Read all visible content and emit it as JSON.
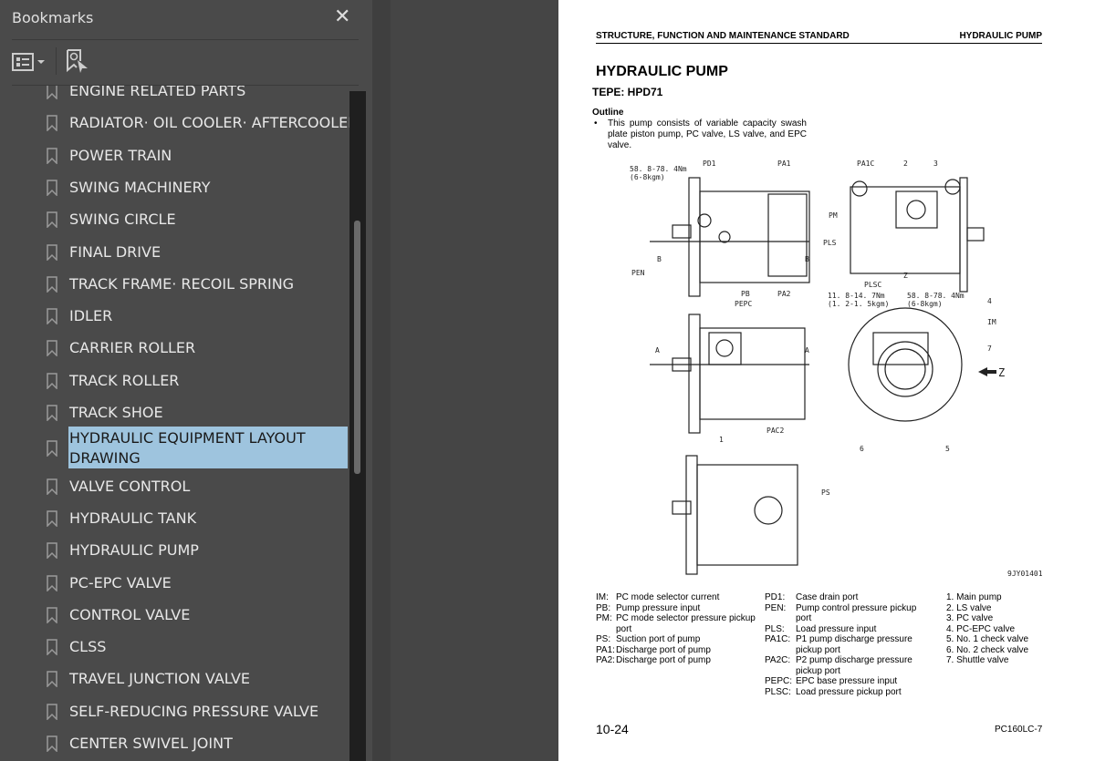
{
  "sidebar": {
    "title": "Bookmarks",
    "close_icon": "close-icon",
    "options_icon": "list-options-icon",
    "find_icon": "find-bookmark-icon",
    "items": [
      {
        "label": "ENGINE RELATED PARTS"
      },
      {
        "label": "RADIATOR· OIL COOLER· AFTERCOOLER"
      },
      {
        "label": "POWER TRAIN"
      },
      {
        "label": "SWING MACHINERY"
      },
      {
        "label": "SWING CIRCLE"
      },
      {
        "label": "FINAL DRIVE"
      },
      {
        "label": "TRACK FRAME· RECOIL SPRING"
      },
      {
        "label": "IDLER"
      },
      {
        "label": "CARRIER ROLLER"
      },
      {
        "label": "TRACK ROLLER"
      },
      {
        "label": "TRACK SHOE"
      },
      {
        "label": "HYDRAULIC EQUIPMENT LAYOUT DRAWING",
        "selected": true
      },
      {
        "label": "VALVE CONTROL"
      },
      {
        "label": "HYDRAULIC TANK"
      },
      {
        "label": "HYDRAULIC PUMP"
      },
      {
        "label": "PC-EPC VALVE"
      },
      {
        "label": "CONTROL VALVE"
      },
      {
        "label": "CLSS"
      },
      {
        "label": "TRAVEL JUNCTION VALVE"
      },
      {
        "label": "SELF-REDUCING PRESSURE VALVE"
      },
      {
        "label": "CENTER SWIVEL JOINT"
      }
    ],
    "selected_color": "#9ec4de"
  },
  "page": {
    "header_left": "STRUCTURE, FUNCTION AND MAINTENANCE STANDARD",
    "header_right": "HYDRAULIC PUMP",
    "title": "HYDRAULIC PUMP",
    "type": "TEPE: HPD71",
    "outline_heading": "Outline",
    "outline_bullet": "•",
    "outline_text": "This pump consists of variable capacity swash plate piston pump, PC valve, LS valve, and EPC valve.",
    "diagram_labels": [
      "58. 8-78. 4Nm",
      "(6-8kgm)",
      "PD1",
      "PA1",
      "PEN",
      "PB",
      "PA2",
      "B",
      "B",
      "PA1C",
      "2",
      "3",
      "PM",
      "PLS",
      "PLSC",
      "Z",
      "11. 8-14. 7Nm",
      "(1. 2-1. 5kgm)",
      "58. 8-78. 4Nm",
      "(6-8kgm)",
      "PEPC",
      "A",
      "A",
      "PAC2",
      "4",
      "IM",
      "7",
      "Z",
      "6",
      "5",
      "1",
      "PS",
      "9JY01401"
    ],
    "legend_col1": [
      [
        "IM:",
        "PC mode selector current"
      ],
      [
        "PB:",
        "Pump pressure input"
      ],
      [
        "PM:",
        "PC mode selector pressure pickup port"
      ],
      [
        "PS:",
        "Suction port of pump"
      ],
      [
        "PA1:",
        "Discharge port of pump"
      ],
      [
        "PA2:",
        "Discharge port of pump"
      ]
    ],
    "legend_col2": [
      [
        "PD1:",
        "Case drain port"
      ],
      [
        "PEN:",
        "Pump control pressure pickup port"
      ],
      [
        "PLS:",
        "Load pressure input"
      ],
      [
        "PA1C:",
        "P1 pump discharge pressure pickup port"
      ],
      [
        "PA2C:",
        "P2 pump discharge pressure pickup port"
      ],
      [
        "PEPC:",
        "EPC base pressure input"
      ],
      [
        "PLSC:",
        "Load pressure pickup port"
      ]
    ],
    "legend_col3": [
      "1. Main pump",
      "2. LS valve",
      "3. PC valve",
      "4. PC-EPC valve",
      "5. No. 1 check valve",
      "6. No. 2 check valve",
      "7. Shuttle valve"
    ],
    "page_number": "10-24",
    "model": "PC160LC-7"
  }
}
